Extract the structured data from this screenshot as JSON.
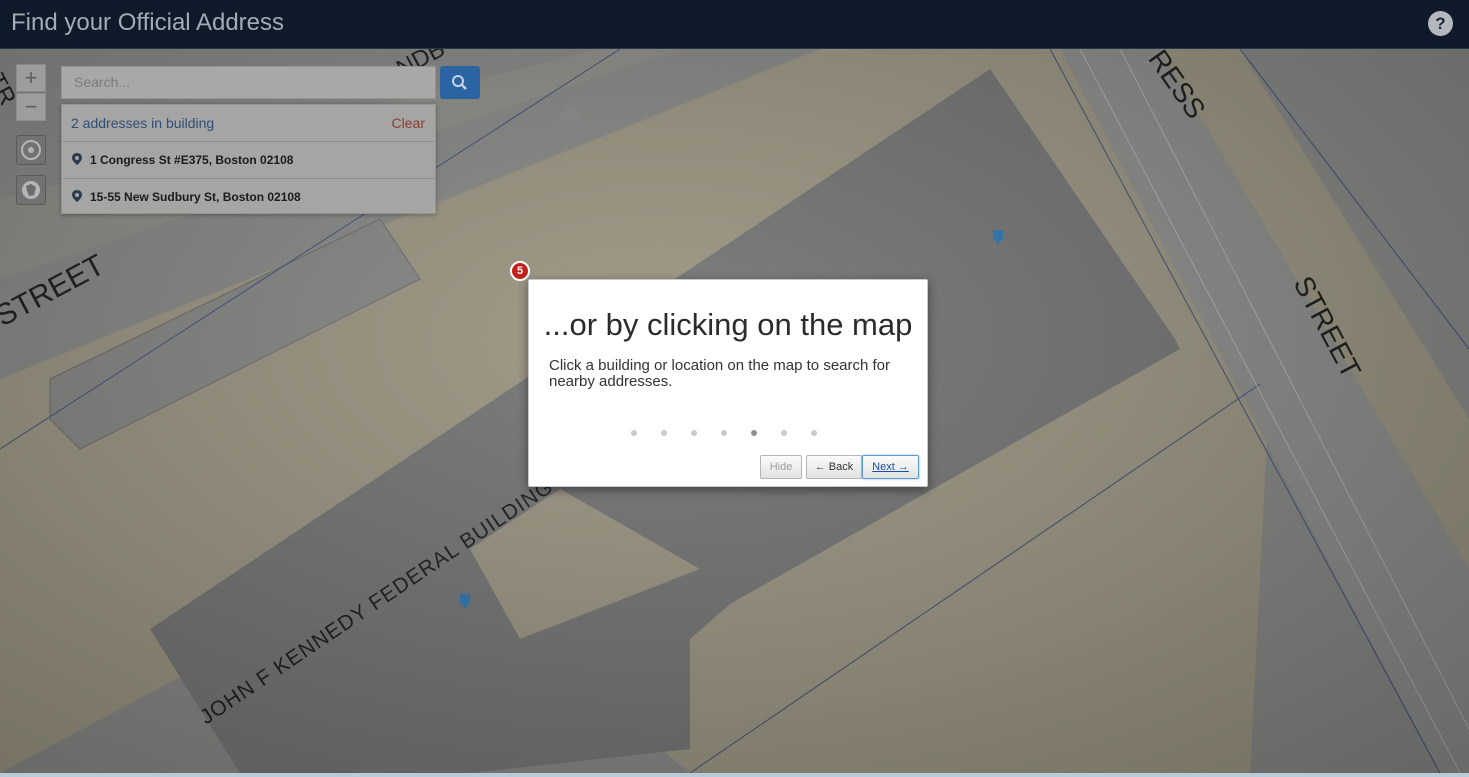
{
  "header": {
    "title": "Find your Official Address",
    "help_glyph": "?"
  },
  "map": {
    "street_labels": [
      "STREET",
      "STREET",
      "RESS",
      "NDB",
      "TR",
      "JOHN F KENNEDY FEDERAL BUILDING"
    ],
    "colors": {
      "street_fill": "#9c9580",
      "building_fill": "#717171",
      "ground": "#8a8a88"
    }
  },
  "controls": {
    "zoom_in": "+",
    "zoom_out": "−",
    "locate_icon": "crosshair-icon",
    "layers_icon": "map-layer-icon"
  },
  "search": {
    "placeholder": "Search...",
    "button_icon": "search-icon"
  },
  "results": {
    "count_label": "2 addresses in building",
    "clear_label": "Clear",
    "items": [
      {
        "address": "1 Congress St #E375, Boston 02108"
      },
      {
        "address": "15-55 New Sudbury St, Boston 02108"
      }
    ]
  },
  "tour": {
    "step_number": "5",
    "title": "...or by clicking on the map",
    "body": "Click a building or location on the map to search for nearby addresses.",
    "total_steps": 7,
    "current_step": 5,
    "hide_label": "Hide",
    "back_label": "← Back",
    "next_label": "Next →"
  }
}
